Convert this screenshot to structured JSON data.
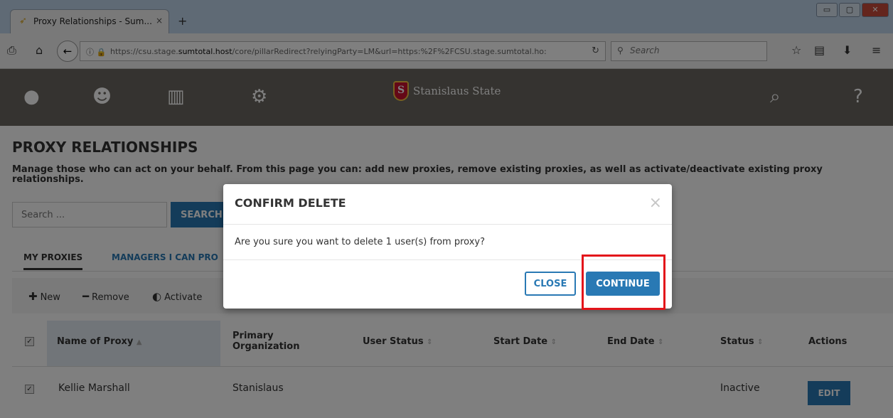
{
  "browser": {
    "tab_title": "Proxy Relationships - Sum...",
    "tab_close": "×",
    "new_tab": "+",
    "url_info": "ⓘ 🔒",
    "url_prefix": "https://csu.stage.",
    "url_host": "sumtotal.host",
    "url_rest": "/core/pillarRedirect?relyingParty=LM&url=https:%2F%2FCSU.stage.sumtotal.ho:",
    "search_placeholder": "Search",
    "window_controls": [
      "▭",
      "▢",
      "✕"
    ]
  },
  "header": {
    "brand": "Stanislaus State",
    "shield_letter": "S"
  },
  "page": {
    "title": "PROXY RELATIONSHIPS",
    "description": "Manage those who can act on your behalf. From this page you can: add new proxies, remove existing proxies, as well as activate/deactivate existing proxy relationships.",
    "search_placeholder": "Search ...",
    "search_button": "SEARCH",
    "tabs": [
      "MY PROXIES",
      "MANAGERS I CAN PRO"
    ],
    "toolbar": {
      "new": "New",
      "remove": "Remove",
      "activate": "Activate"
    }
  },
  "table": {
    "headers": {
      "name": "Name of Proxy",
      "org_line1": "Primary",
      "org_line2": "Organization",
      "user_status": "User Status",
      "start_date": "Start Date",
      "end_date": "End Date",
      "status": "Status",
      "actions": "Actions"
    },
    "rows": [
      {
        "name": "Kellie Marshall",
        "org": "Stanislaus",
        "status": "Inactive",
        "action": "EDIT"
      }
    ]
  },
  "modal": {
    "title": "CONFIRM DELETE",
    "close_x": "×",
    "body": "Are you sure you want to delete 1 user(s) from proxy?",
    "close_label": "CLOSE",
    "continue_label": "CONTINUE"
  },
  "colors": {
    "primary": "#2979b4",
    "header_bg": "#6b6760",
    "highlight": "#e3141a"
  }
}
